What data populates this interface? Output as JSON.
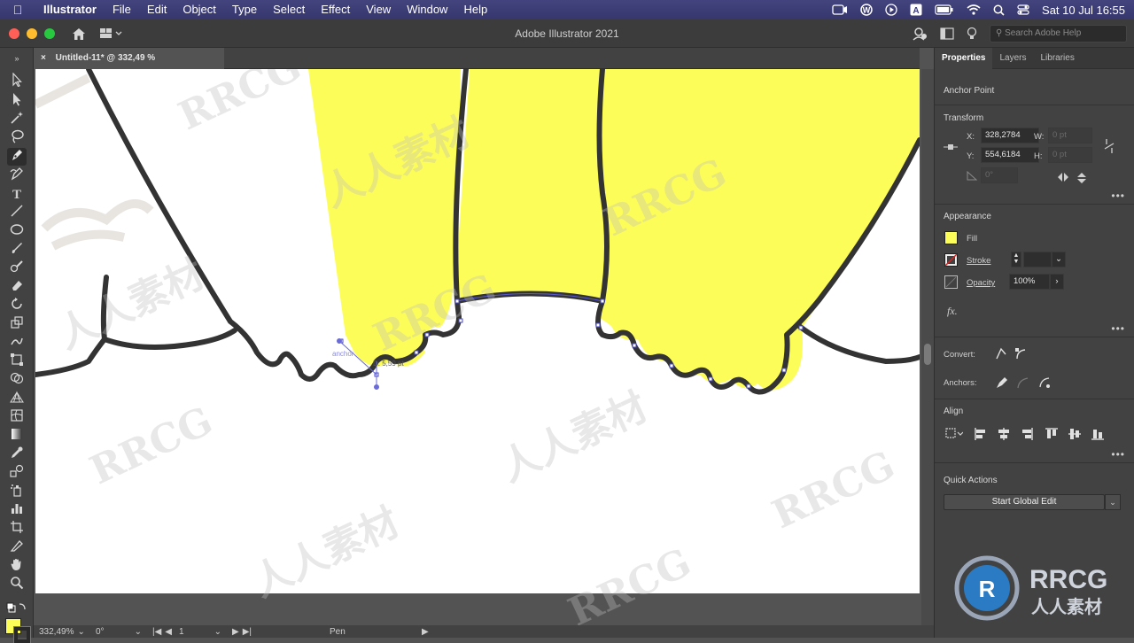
{
  "menubar": {
    "app": "Illustrator",
    "items": [
      "File",
      "Edit",
      "Object",
      "Type",
      "Select",
      "Effect",
      "View",
      "Window",
      "Help"
    ],
    "clock": "Sat 10 Jul  16:55"
  },
  "titlebar": {
    "title": "Adobe Illustrator 2021",
    "search_placeholder": "Search Adobe Help"
  },
  "document": {
    "tab_label": "Untitled-11* @ 332,49 % (CMYK/Preview)",
    "close_glyph": "×"
  },
  "canvas": {
    "measure_label": "D: 5,59 pt",
    "anchor_hint": "anchor",
    "fill_color": "#fdfd5a",
    "stroke_color": "#333333"
  },
  "panel": {
    "tabs": [
      "Properties",
      "Layers",
      "Libraries"
    ],
    "selection_type": "Anchor Point",
    "transform": {
      "title": "Transform",
      "x_label": "X:",
      "x_value": "328,2784",
      "y_label": "Y:",
      "y_value": "554,6184",
      "w_label": "W:",
      "w_value": "0 pt",
      "h_label": "H:",
      "h_value": "0 pt",
      "angle_value": "0°"
    },
    "appearance": {
      "title": "Appearance",
      "fill_label": "Fill",
      "stroke_label": "Stroke",
      "opacity_label": "Opacity",
      "opacity_value": "100%",
      "fx": "fx."
    },
    "convert_label": "Convert:",
    "anchors_label": "Anchors:",
    "align_title": "Align",
    "quick_actions": {
      "title": "Quick Actions",
      "button": "Start Global Edit"
    }
  },
  "statusbar": {
    "zoom": "332,49%",
    "rotation": "0°",
    "artboard": "1",
    "tool": "Pen"
  },
  "watermarks": [
    "RRCG",
    "人人素材"
  ],
  "logo": {
    "line1": "RRCG",
    "line2": "人人素材"
  }
}
